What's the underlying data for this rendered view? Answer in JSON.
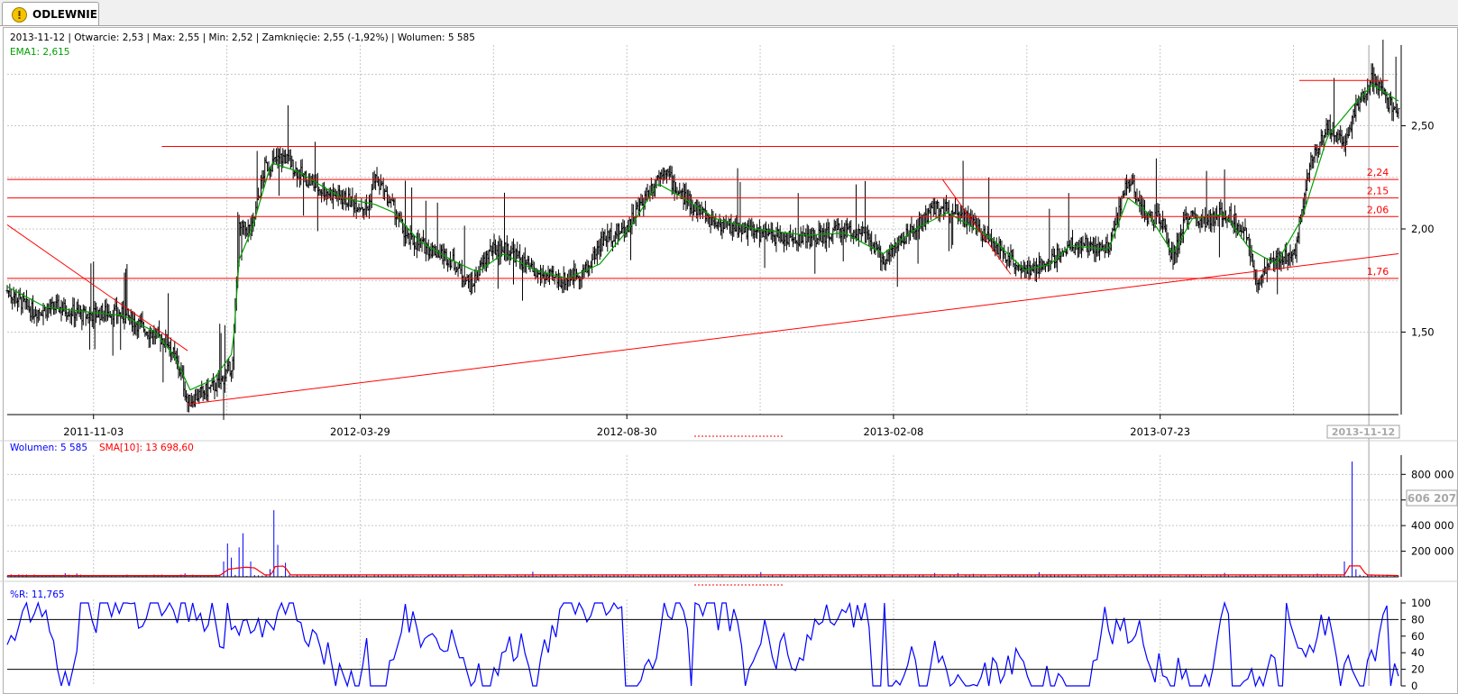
{
  "tab": {
    "label": "ODLEWNIE",
    "icon": "exclamation-icon"
  },
  "price_panel": {
    "info_line": "2013-11-12 | Otwarcie: 2,53 | Max: 2,55 | Min: 2,52 | Zamknięcie: 2,55 (-1,92%)  | Wolumen: 5 585",
    "ema_label": "EMA1: 2,615",
    "current_date_label": "2013-11-12"
  },
  "volume_panel": {
    "volume_label": "Wolumen: 5 585",
    "sma_label": "SMA[10]: 13 698,60",
    "current_value_label": "606 207"
  },
  "wr_panel": {
    "label": "%R: 11,765"
  },
  "colors": {
    "price": "#000000",
    "ema": "#00a000",
    "lines": "#ff0000",
    "volume": "#0000ff",
    "sma": "#ff0000",
    "wr": "#0000ff",
    "grid": "#c8c8c8"
  },
  "chart_data": [
    {
      "type": "ohlc",
      "title": "",
      "x_ticks": [
        "2011-11-03",
        "2012-03-29",
        "2012-08-30",
        "2013-02-08",
        "2013-07-23"
      ],
      "y_ticks": [
        "1,50",
        "2,00",
        "2,50"
      ],
      "ylim": [
        1.1,
        2.9
      ],
      "grid": true,
      "hlines": [
        {
          "value": 2.4,
          "label": ""
        },
        {
          "value": 2.24,
          "label": "2,24"
        },
        {
          "value": 2.15,
          "label": "2,15"
        },
        {
          "value": 2.06,
          "label": "2,06"
        },
        {
          "value": 1.76,
          "label": "1,76"
        },
        {
          "value": 2.72,
          "label": ""
        }
      ],
      "close_anchors": [
        [
          0,
          1.7
        ],
        [
          20,
          1.6
        ],
        [
          40,
          1.62
        ],
        [
          60,
          1.58
        ],
        [
          80,
          1.6
        ],
        [
          95,
          1.57
        ],
        [
          110,
          1.5
        ],
        [
          125,
          1.45
        ],
        [
          135,
          1.3
        ],
        [
          140,
          1.16
        ],
        [
          150,
          1.2
        ],
        [
          165,
          1.25
        ],
        [
          175,
          1.35
        ],
        [
          180,
          2.0
        ],
        [
          190,
          2.0
        ],
        [
          200,
          2.3
        ],
        [
          215,
          2.35
        ],
        [
          225,
          2.28
        ],
        [
          240,
          2.2
        ],
        [
          260,
          2.15
        ],
        [
          280,
          2.1
        ],
        [
          285,
          2.25
        ],
        [
          300,
          2.1
        ],
        [
          310,
          1.95
        ],
        [
          330,
          1.9
        ],
        [
          345,
          1.85
        ],
        [
          360,
          1.72
        ],
        [
          375,
          1.9
        ],
        [
          390,
          1.9
        ],
        [
          410,
          1.78
        ],
        [
          430,
          1.75
        ],
        [
          450,
          1.8
        ],
        [
          462,
          1.95
        ],
        [
          480,
          2.0
        ],
        [
          495,
          2.15
        ],
        [
          510,
          2.3
        ],
        [
          520,
          2.18
        ],
        [
          535,
          2.1
        ],
        [
          550,
          2.03
        ],
        [
          570,
          2.0
        ],
        [
          590,
          1.97
        ],
        [
          610,
          1.95
        ],
        [
          630,
          1.96
        ],
        [
          650,
          2.0
        ],
        [
          665,
          1.97
        ],
        [
          680,
          1.85
        ],
        [
          690,
          1.92
        ],
        [
          705,
          2.0
        ],
        [
          720,
          2.1
        ],
        [
          735,
          2.1
        ],
        [
          750,
          2.02
        ],
        [
          765,
          1.93
        ],
        [
          780,
          1.85
        ],
        [
          795,
          1.78
        ],
        [
          810,
          1.85
        ],
        [
          825,
          1.92
        ],
        [
          840,
          1.92
        ],
        [
          855,
          1.9
        ],
        [
          870,
          2.25
        ],
        [
          885,
          2.05
        ],
        [
          895,
          2.05
        ],
        [
          905,
          1.85
        ],
        [
          915,
          2.06
        ],
        [
          930,
          2.03
        ],
        [
          945,
          2.08
        ],
        [
          960,
          2.0
        ],
        [
          970,
          1.75
        ],
        [
          985,
          1.85
        ],
        [
          1000,
          1.9
        ],
        [
          1010,
          2.3
        ],
        [
          1025,
          2.5
        ],
        [
          1038,
          2.42
        ],
        [
          1048,
          2.6
        ],
        [
          1060,
          2.73
        ],
        [
          1068,
          2.65
        ],
        [
          1080,
          2.55
        ]
      ],
      "ema_anchors": [
        [
          0,
          1.72
        ],
        [
          30,
          1.62
        ],
        [
          60,
          1.6
        ],
        [
          90,
          1.58
        ],
        [
          115,
          1.5
        ],
        [
          130,
          1.38
        ],
        [
          142,
          1.22
        ],
        [
          160,
          1.27
        ],
        [
          175,
          1.4
        ],
        [
          180,
          1.85
        ],
        [
          190,
          2.0
        ],
        [
          205,
          2.32
        ],
        [
          225,
          2.28
        ],
        [
          260,
          2.15
        ],
        [
          285,
          2.12
        ],
        [
          300,
          2.08
        ],
        [
          320,
          1.94
        ],
        [
          345,
          1.85
        ],
        [
          365,
          1.79
        ],
        [
          385,
          1.88
        ],
        [
          410,
          1.8
        ],
        [
          435,
          1.76
        ],
        [
          460,
          1.83
        ],
        [
          485,
          2.02
        ],
        [
          505,
          2.22
        ],
        [
          525,
          2.15
        ],
        [
          550,
          2.05
        ],
        [
          580,
          2.0
        ],
        [
          620,
          1.97
        ],
        [
          650,
          1.98
        ],
        [
          680,
          1.88
        ],
        [
          705,
          2.0
        ],
        [
          730,
          2.08
        ],
        [
          765,
          1.95
        ],
        [
          790,
          1.8
        ],
        [
          810,
          1.83
        ],
        [
          825,
          1.92
        ],
        [
          855,
          1.9
        ],
        [
          870,
          2.15
        ],
        [
          885,
          2.08
        ],
        [
          905,
          1.88
        ],
        [
          920,
          2.05
        ],
        [
          945,
          2.07
        ],
        [
          965,
          1.9
        ],
        [
          985,
          1.83
        ],
        [
          1005,
          2.05
        ],
        [
          1025,
          2.45
        ],
        [
          1045,
          2.6
        ],
        [
          1060,
          2.7
        ],
        [
          1080,
          2.62
        ]
      ],
      "trendlines": [
        {
          "from": [
            "2011-09",
            2.02
          ],
          "to": [
            "2012-01",
            1.41
          ]
        },
        {
          "from": [
            "2012-01",
            1.15
          ],
          "to": [
            "2013-11-12",
            1.88
          ]
        },
        {
          "from": [
            "2013-02",
            2.24
          ],
          "to": [
            "2013-04",
            1.78
          ]
        }
      ]
    },
    {
      "type": "bar",
      "title": "",
      "y_ticks": [
        "200 000",
        "400 000",
        "600 000",
        "800 000"
      ],
      "ylim": [
        0,
        950000
      ],
      "current_value": 606207,
      "spikes": [
        [
          170,
          120000
        ],
        [
          172,
          260000
        ],
        [
          175,
          150000
        ],
        [
          180,
          230000
        ],
        [
          185,
          340000
        ],
        [
          190,
          120000
        ],
        [
          205,
          60000
        ],
        [
          207,
          520000
        ],
        [
          212,
          250000
        ],
        [
          216,
          110000
        ],
        [
          410,
          40000
        ],
        [
          720,
          30000
        ],
        [
          1040,
          120000
        ],
        [
          1045,
          900000
        ],
        [
          1048,
          60000
        ]
      ],
      "sma_anchors": [
        [
          0,
          10000
        ],
        [
          165,
          10000
        ],
        [
          172,
          60000
        ],
        [
          180,
          70000
        ],
        [
          185,
          75000
        ],
        [
          192,
          70000
        ],
        [
          200,
          15000
        ],
        [
          205,
          15000
        ],
        [
          208,
          80000
        ],
        [
          215,
          85000
        ],
        [
          220,
          15000
        ],
        [
          1038,
          15000
        ],
        [
          1042,
          85000
        ],
        [
          1050,
          85000
        ],
        [
          1055,
          15000
        ],
        [
          1080,
          10000
        ]
      ]
    },
    {
      "type": "line",
      "title": "",
      "y_ticks": [
        "0",
        "20",
        "40",
        "60",
        "80",
        "100"
      ],
      "ylim": [
        0,
        100
      ],
      "hlines": [
        20,
        80
      ],
      "last_value": 11.765
    }
  ]
}
